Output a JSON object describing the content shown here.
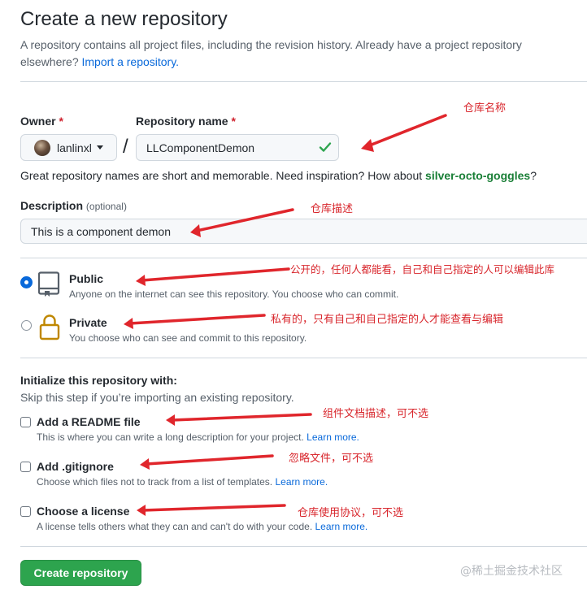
{
  "page": {
    "title": "Create a new repository",
    "intro_text": "A repository contains all project files, including the revision history. Already have a project repository elsewhere?",
    "import_link": "Import a repository."
  },
  "owner": {
    "label": "Owner",
    "required_mark": "*",
    "value": "lanlinxl"
  },
  "repo": {
    "label": "Repository name",
    "required_mark": "*",
    "value": "LLComponentDemon",
    "separator": "/"
  },
  "hint": {
    "text": "Great repository names are short and memorable. Need inspiration? How about",
    "suggestion": "silver-octo-goggles",
    "end": "?"
  },
  "description": {
    "label": "Description",
    "optional": "(optional)",
    "value": "This is a component demon"
  },
  "visibility": {
    "public": {
      "title": "Public",
      "subtitle": "Anyone on the internet can see this repository. You choose who can commit.",
      "selected": true
    },
    "private": {
      "title": "Private",
      "subtitle": "You choose who can see and commit to this repository.",
      "selected": false
    }
  },
  "initialize": {
    "heading": "Initialize this repository with:",
    "subheading": "Skip this step if you’re importing an existing repository.",
    "readme": {
      "label": "Add a README file",
      "desc": "This is where you can write a long description for your project.",
      "link": "Learn more.",
      "checked": false
    },
    "gitignore": {
      "label": "Add .gitignore",
      "desc": "Choose which files not to track from a list of templates.",
      "link": "Learn more.",
      "checked": false
    },
    "license": {
      "label": "Choose a license",
      "desc": "A license tells others what they can and can't do with your code.",
      "link": "Learn more.",
      "checked": false
    }
  },
  "create_button": "Create repository",
  "annotations": {
    "repo_name": "仓库名称",
    "description": "仓库描述",
    "public": "公开的，任何人都能看，自己和自己指定的人可以编辑此库",
    "private": "私有的，只有自己和自己指定的人才能查看与编辑",
    "readme": "组件文档描述，可不选",
    "gitignore": "忽略文件，可不选",
    "license": "仓库使用协议，可不选"
  },
  "watermark": "@稀土掘金技术社区",
  "colors": {
    "primary_button": "#2da44e",
    "link": "#0969da",
    "suggestion": "#1a7f37",
    "required": "#cf222e",
    "annotation": "#d8262c",
    "lock_icon": "#bf8700"
  },
  "icons": {
    "avatar": "avatar",
    "caret": "caret-down-icon",
    "check": "check-icon",
    "public": "repo-icon",
    "private": "lock-icon"
  }
}
